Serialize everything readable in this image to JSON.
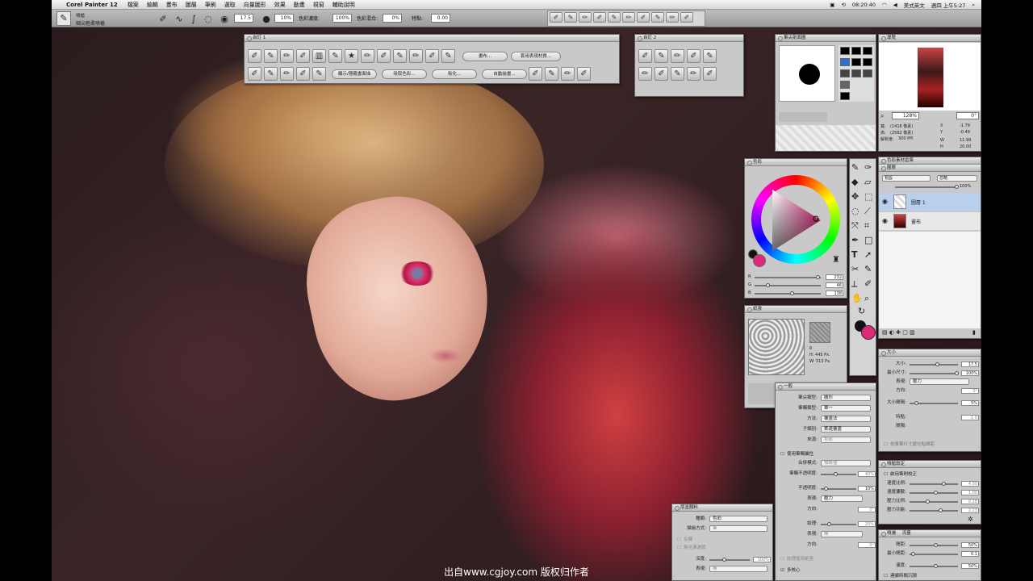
{
  "menubar": {
    "app": "Corel Painter 12",
    "items": [
      "檔案",
      "編輯",
      "畫布",
      "圖層",
      "筆刷",
      "選取",
      "向量圖形",
      "效果",
      "動畫",
      "視窗",
      "輔助說明"
    ],
    "clock": "08:20:40",
    "ime": "美式英文",
    "date": "週四 上午5:27"
  },
  "propbar": {
    "brush_category": "噴槍",
    "brush_variant": "細尖輕柔噴槍",
    "size": "17.5",
    "opacity": "10%",
    "color_variability_label": "色彩濃度:",
    "color_variability": "100%",
    "color_mix_label": "色彩混合:",
    "color_mix": "0%",
    "feature_label": "特點:",
    "feature": "0.00"
  },
  "panel_brushes1": {
    "title": "自訂 1",
    "btn_a": "畫布...",
    "btn_b": "套用表現材質...",
    "btn_c": "顯示/隱藏畫面描",
    "btn_d": "吸取色彩...",
    "btn_e": "吸化...",
    "btn_f": "自動繪畫..."
  },
  "panel_brushes2": {
    "title": "自訂 2"
  },
  "panel_dab": {
    "title": "筆尖剖面圖"
  },
  "panel_nav": {
    "title": "導覽",
    "zoom": "128%",
    "angle": "0°",
    "w_label": "寬:",
    "w": "(1416 像素)",
    "h_label": "高:",
    "h": "(2562 像素)",
    "res_label": "解析度:",
    "res": "300 PPI",
    "x_label": "X",
    "x": "-1.79",
    "y_label": "Y",
    "y": "-0.49",
    "ww_label": "W",
    "ww": "11.99",
    "hh_label": "H",
    "hh": "20.00"
  },
  "panel_color": {
    "title": "色彩",
    "r_label": "R",
    "r": "232",
    "g_label": "G",
    "g": "46",
    "b_label": "B",
    "b": "138",
    "main_color": "#e0287a"
  },
  "panel_paper": {
    "title": "紙張",
    "v1": "6",
    "w": "H: 445 Px.",
    "h": "W: 313 Px."
  },
  "panel_layers": {
    "title": "圖層",
    "tab2": "色彩素材倉庫",
    "blend": "預設",
    "composite": "忽略",
    "opacity": "100%",
    "layer1": "圖層 1",
    "layer2": "畫布"
  },
  "panel_size": {
    "title": "大小",
    "size_label": "大小:",
    "size": "17.5",
    "min_label": "最小尺寸:",
    "min": "100%",
    "expr_label": "表現:",
    "expr": "壓力",
    "dir_label": "方向:",
    "dir": "0°",
    "step_label": "大小間隔:",
    "step": "5%",
    "feat_label": "特點:",
    "feat": "1.0",
    "jit_label": "間隔:",
    "check1": "依畫筆尺寸變化點間距"
  },
  "panel_general": {
    "title": "一般",
    "dab_label": "筆尖類型:",
    "dab": "圓形",
    "stroke_label": "筆觸類型:",
    "stroke": "單一",
    "method_label": "方法:",
    "method": "覆蓋法",
    "sub_label": "子類別:",
    "sub": "柔邊覆蓋",
    "source_label": "來源:",
    "source": "色彩",
    "check_stroke": "使用筆觸屬性",
    "blend_label": "合併模式:",
    "blend": "預設值",
    "stroke_op_label": "筆觸不透明度:",
    "stroke_op": "40%",
    "opacity_label": "不透明度:",
    "opacity": "10%",
    "expr_label": "表現:",
    "expr": "壓力",
    "dir_label": "方向:",
    "dir": "0°",
    "grain_label": "紋理:",
    "grain": "20%",
    "g_expr_label": "表現:",
    "g_expr": "無",
    "g_dir_label": "方向:",
    "g_dir": "0°",
    "check_paper": "紋理使用紙張",
    "multicore": "多核心"
  },
  "panel_airbrush": {
    "title": "噴槍設定",
    "check1": "啟用筆刷校正",
    "r1_label": "速度比例:",
    "r1": "4.00",
    "r2_label": "速度擴散:",
    "r2": "1.00",
    "r3_label": "壓力比例:",
    "r3": "0.28",
    "r4_label": "壓力功能:",
    "r4": "2.23"
  },
  "panel_spray": {
    "title": "噴灑",
    "tab": "流量",
    "r1_label": "間距:",
    "r1": "50%",
    "r2_label": "最小間距:",
    "r2": "0.1",
    "r3_label": "灌度:",
    "r3": "50%",
    "check1": "連續時間沉積"
  },
  "panel_mixer": {
    "title": "厚塗顏料",
    "r1_label": "種類:",
    "r1": "色彩",
    "r2_label": "描繪方式:",
    "r2": "筆",
    "check1": "反轉",
    "check2": "無光澤濾鏡",
    "r3_label": "深度:",
    "r3": "100%",
    "r4_label": "表現:",
    "r4": "無"
  },
  "watermark": "出自www.cgjoy.com 版权归作者"
}
